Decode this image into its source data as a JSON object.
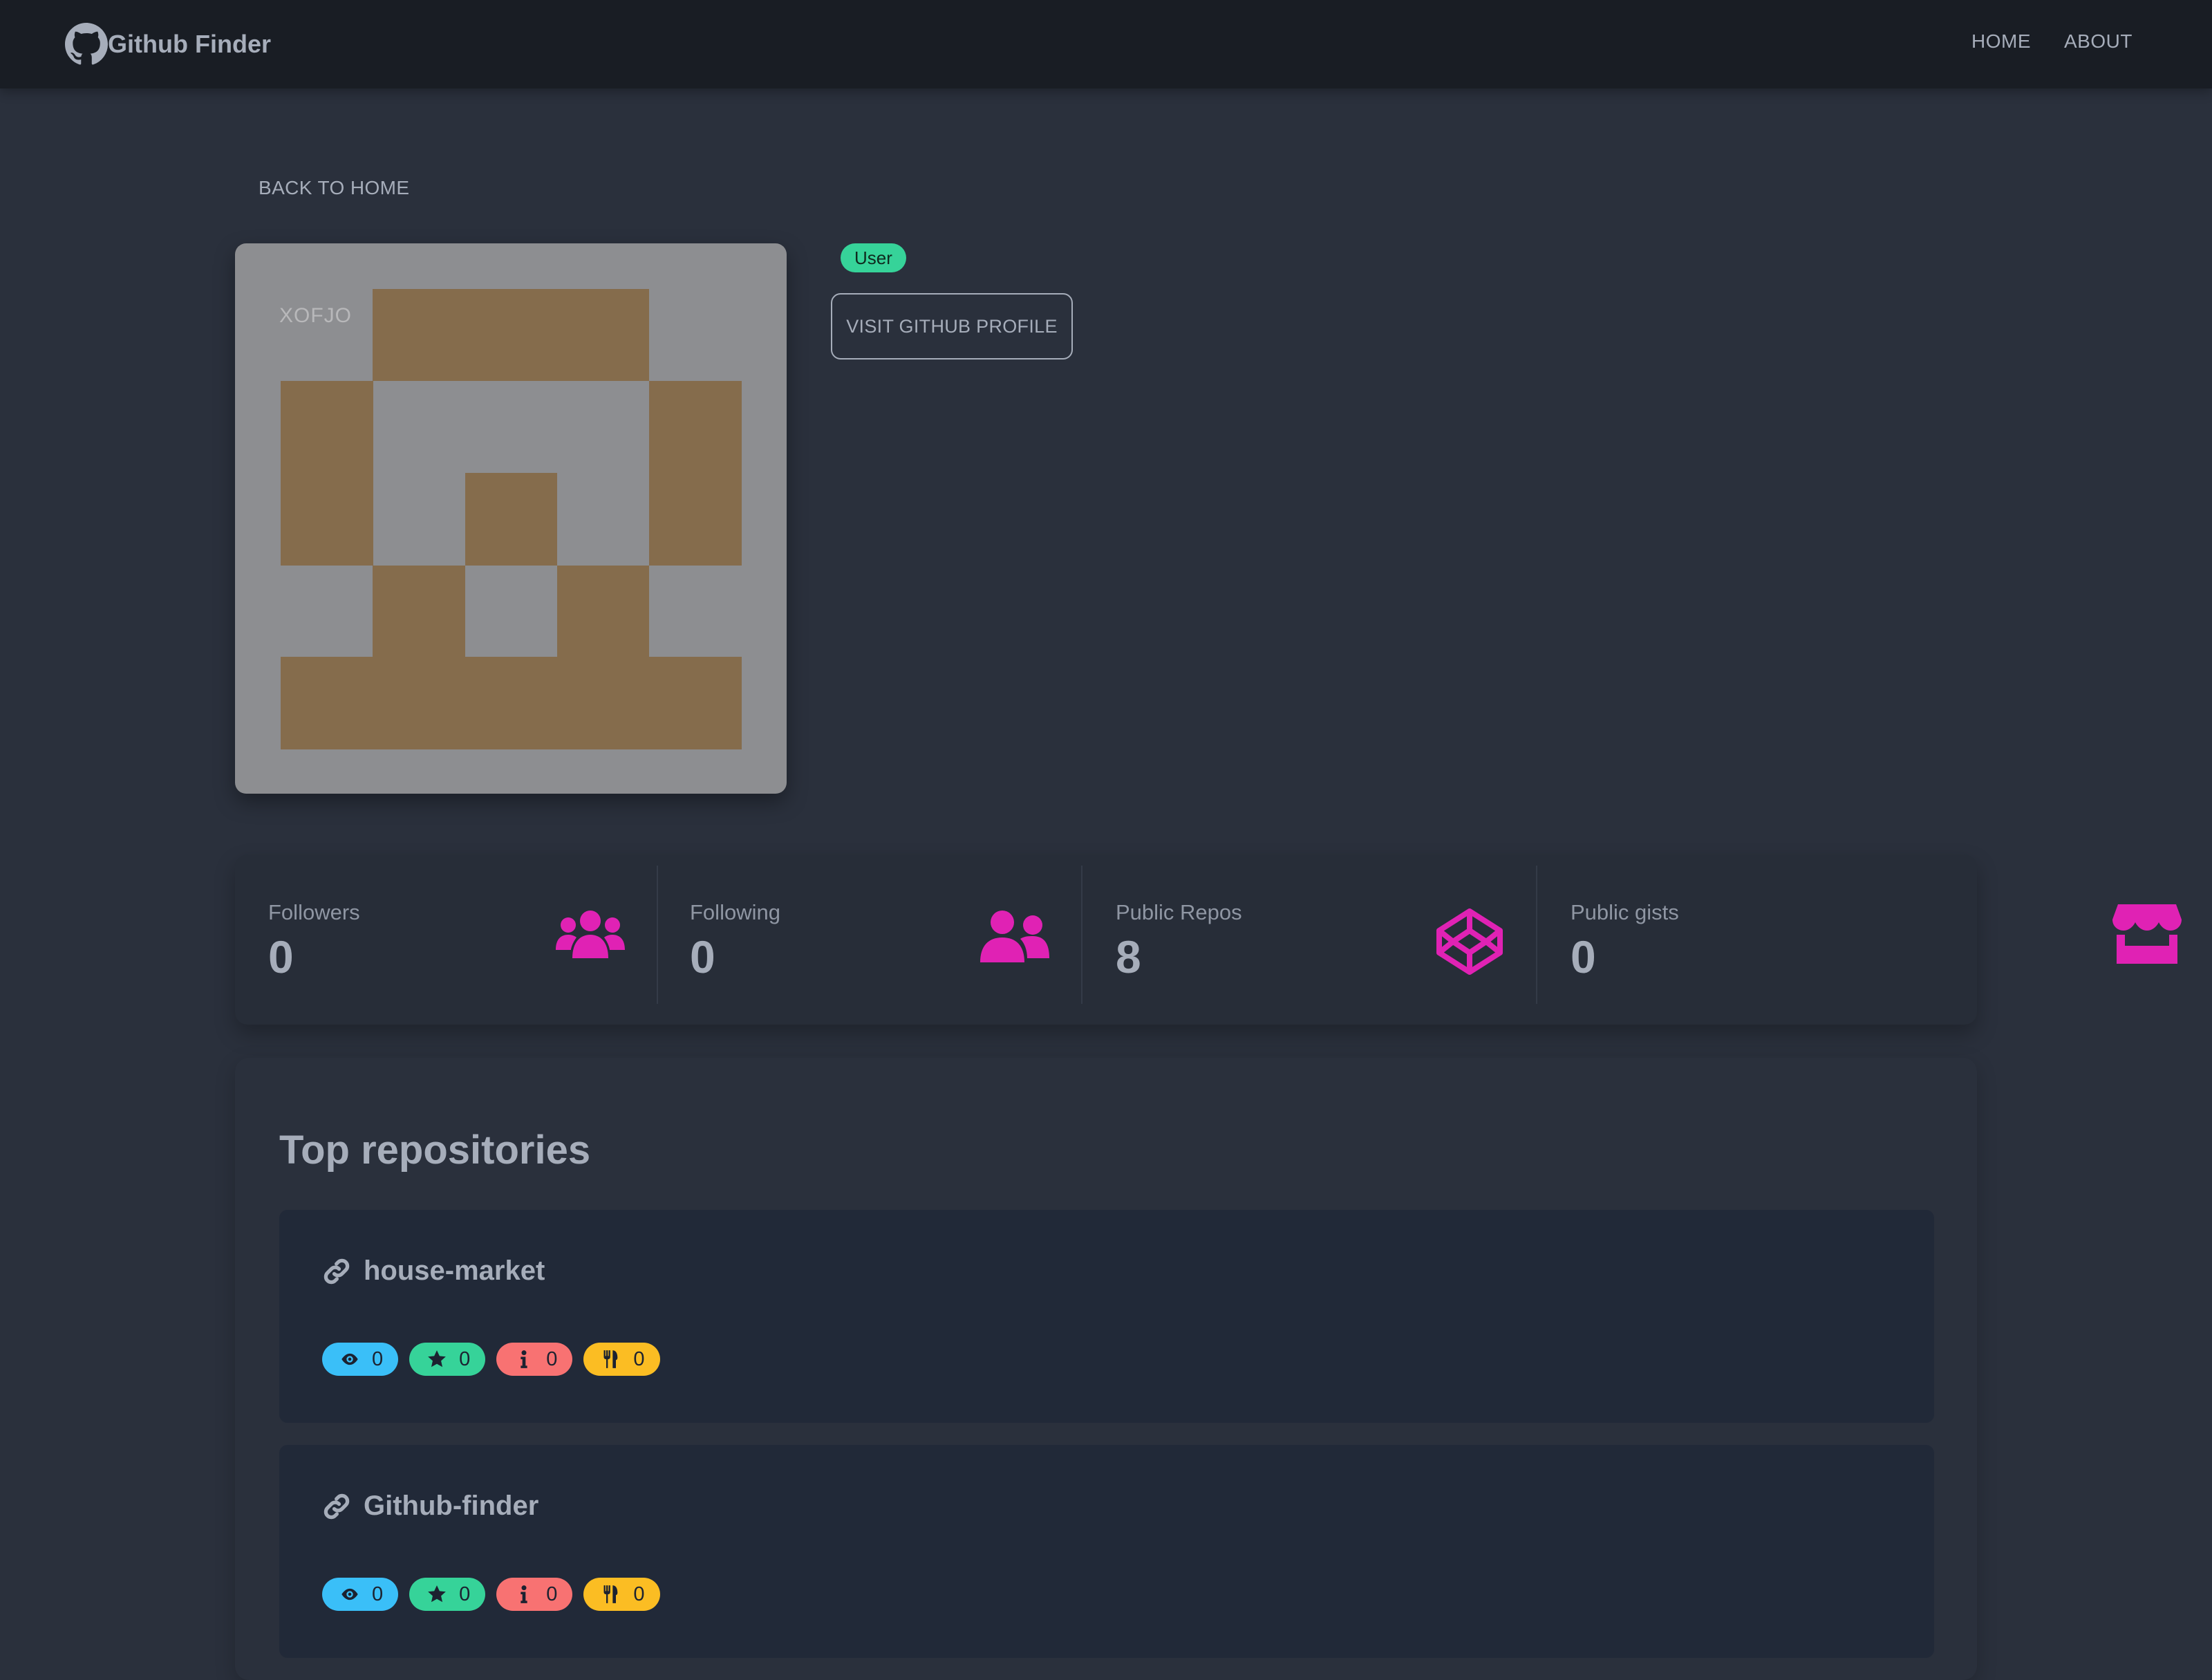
{
  "navbar": {
    "brand_icon": "github-icon",
    "brand_title": "Github Finder",
    "links": [
      "HOME",
      "ABOUT"
    ]
  },
  "back_link": "BACK TO HOME",
  "profile": {
    "avatar_name": "XOFJO",
    "type_badge": "User",
    "visit_button": "VISIT GITHUB PROFILE"
  },
  "stats": [
    {
      "title": "Followers",
      "value": "0",
      "icon": "users-icon"
    },
    {
      "title": "Following",
      "value": "0",
      "icon": "user-friends-icon"
    },
    {
      "title": "Public Repos",
      "value": "8",
      "icon": "codepen-icon"
    },
    {
      "title": "Public gists",
      "value": "0",
      "icon": "store-icon"
    }
  ],
  "repositories_title": "Top repositories",
  "repositories": [
    {
      "name": "house-market",
      "watchers": "0",
      "stars": "0",
      "issues": "0",
      "forks": "0"
    },
    {
      "name": "Github-finder",
      "watchers": "0",
      "stars": "0",
      "issues": "0",
      "forks": "0"
    }
  ],
  "colors": {
    "accent_icon": "#e022b4",
    "badge_user": "#36d399",
    "badge_watch": "#3abff8",
    "badge_star": "#36d399",
    "badge_issue": "#f87272",
    "badge_fork": "#fbbd23",
    "avatar_fg": "#856c4c",
    "avatar_bg": "#8d8e91"
  }
}
